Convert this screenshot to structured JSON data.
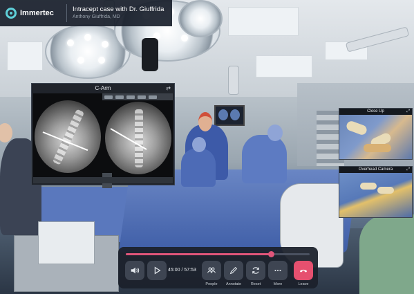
{
  "header": {
    "brand": "Immertec",
    "session_title": "Intracept case with Dr. Giuffrida",
    "session_subtitle": "Anthony Giuffrida, MD"
  },
  "carm_panel": {
    "title": "C-Arm",
    "swap_icon": "swap-icon"
  },
  "feeds": [
    {
      "label": "Close Up",
      "expand_icon": "expand-icon"
    },
    {
      "label": "Overhead Camera",
      "expand_icon": "expand-icon"
    }
  ],
  "playback": {
    "progress_fraction": 0.79,
    "current_time": "45:00",
    "separator": "/",
    "total_time": "57:53",
    "time_display": "45:00 / 57:53"
  },
  "controls": {
    "volume_icon": "volume-icon",
    "play_icon": "play-icon",
    "people_label": "People",
    "annotate_label": "Annotate",
    "reset_label": "Reset",
    "more_label": "More",
    "leave_label": "Leave"
  },
  "colors": {
    "accent": "#e0557a",
    "brand": "#5fd0d9",
    "panel": "#1c212c"
  }
}
